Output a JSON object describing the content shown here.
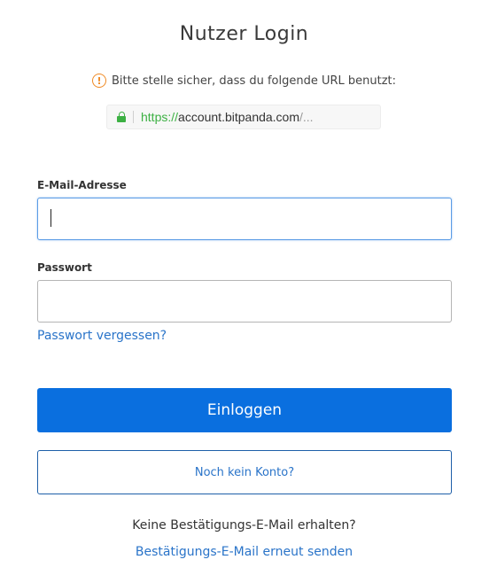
{
  "page": {
    "title": "Nutzer Login"
  },
  "warning": {
    "icon": "exclamation-circle-icon",
    "icon_glyph": "!",
    "text": "Bitte stelle sicher, dass du folgende URL benutzt:"
  },
  "urlbar": {
    "lock_icon": "lock-icon",
    "scheme": "https://",
    "host": "account.bitpanda.com",
    "rest": "/..."
  },
  "form": {
    "email_label": "E-Mail-Adresse",
    "email_value": "",
    "password_label": "Passwort",
    "password_value": "",
    "forgot_password": "Passwort vergessen?"
  },
  "actions": {
    "login_label": "Einloggen",
    "no_account_label": "Noch kein Konto?"
  },
  "confirmation": {
    "question": "Keine Bestätigungs-E-Mail erhalten?",
    "resend_link": "Bestätigungs-E-Mail erneut senden"
  },
  "colors": {
    "primary": "#0a6fdf",
    "link": "#2a74c9",
    "secure_green": "#3cb043",
    "warning_orange": "#f08a24"
  }
}
